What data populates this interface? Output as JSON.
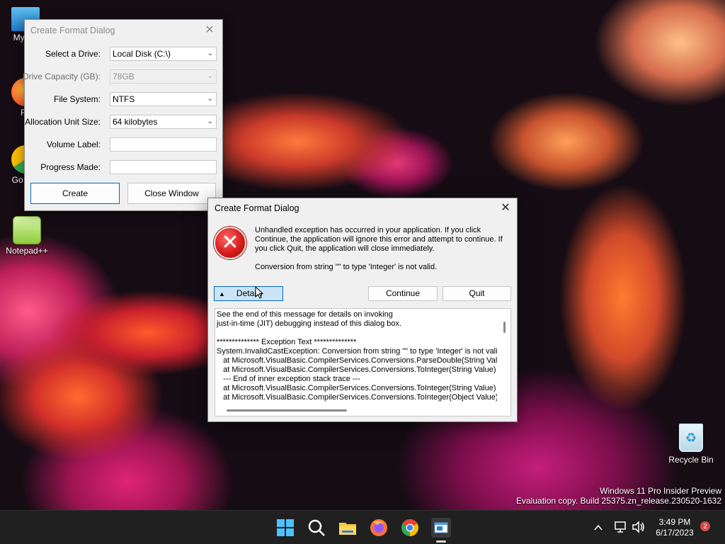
{
  "desktop": {
    "icons": [
      {
        "label": "My Co"
      },
      {
        "label": "Fir"
      },
      {
        "label": "Go Chr"
      },
      {
        "label": "Notepad++"
      }
    ],
    "recycle_bin": {
      "label": "Recycle Bin"
    },
    "watermark": {
      "line1": "Windows 11 Pro Insider Preview",
      "line2": "Evaluation copy. Build 25375.zn_release.230520-1632"
    }
  },
  "format_window": {
    "title": "Create Format Dialog",
    "fields": {
      "drive_label": "Select a Drive:",
      "drive_value": "Local Disk (C:\\)",
      "capacity_label": "Drive Capacity (GB):",
      "capacity_value": "78GB",
      "filesystem_label": "File System:",
      "filesystem_value": "NTFS",
      "alloc_label": "Allocation Unit Size:",
      "alloc_value": "64 kilobytes",
      "volume_label": "Volume Label:",
      "volume_value": "",
      "progress_label": "Progress Made:",
      "progress_value": ""
    },
    "buttons": {
      "create": "Create",
      "close": "Close Window"
    }
  },
  "error_dialog": {
    "title": "Create Format Dialog",
    "message": "Unhandled exception has occurred in your application. If you click Continue, the application will ignore this error and attempt to continue. If you click Quit, the application will close immediately.",
    "detail": "Conversion from string \"\" to type 'Integer' is not valid.",
    "buttons": {
      "details": "Details",
      "continue": "Continue",
      "quit": "Quit"
    },
    "details_text": "See the end of this message for details on invoking\njust-in-time (JIT) debugging instead of this dialog box.\n\n************** Exception Text **************\nSystem.InvalidCastException: Conversion from string \"\" to type 'Integer' is not valid. --->\n   at Microsoft.VisualBasic.CompilerServices.Conversions.ParseDouble(String Value, N\n   at Microsoft.VisualBasic.CompilerServices.Conversions.ToInteger(String Value)\n   --- End of inner exception stack trace ---\n   at Microsoft.VisualBasic.CompilerServices.Conversions.ToInteger(String Value)\n   at Microsoft.VisualBasic.CompilerServices.Conversions.ToInteger(Object Value)"
  },
  "taskbar": {
    "icons": [
      "windows-start-icon",
      "search-icon",
      "file-explorer-icon",
      "firefox-icon",
      "chrome-icon",
      "app-window-icon"
    ],
    "clock": {
      "time": "3:49 PM",
      "date": "6/17/2023"
    },
    "notification_count": "2"
  },
  "colors": {
    "accent": "#0067c0",
    "taskbar": "#202020",
    "dialog_bg": "#f0f0f0",
    "error_red": "#d81c1c"
  }
}
